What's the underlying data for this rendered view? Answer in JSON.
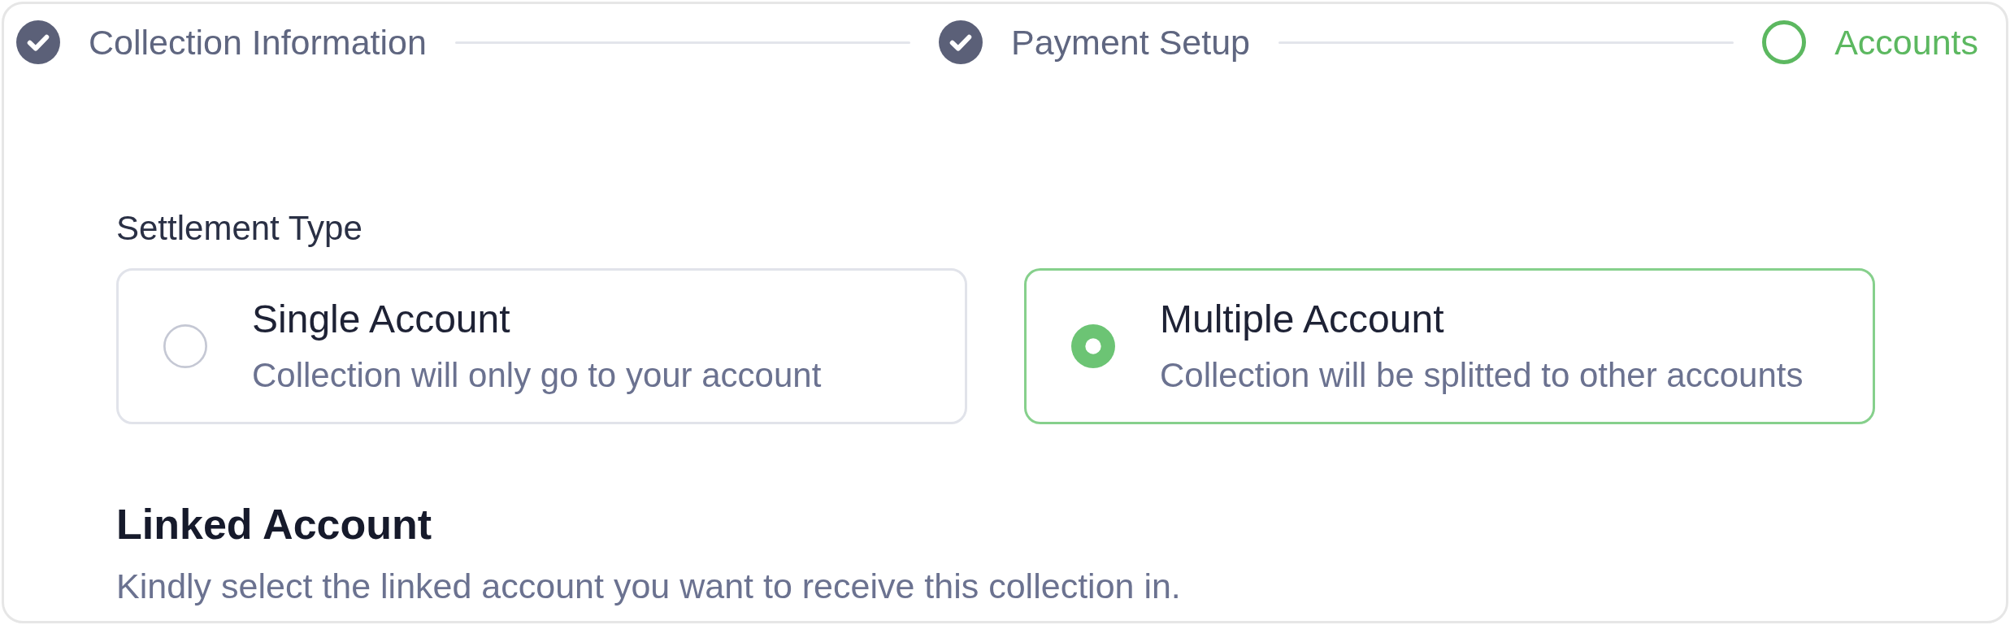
{
  "steps": [
    {
      "label": "Collection Information",
      "completed": true,
      "active": false
    },
    {
      "label": "Payment Setup",
      "completed": true,
      "active": false
    },
    {
      "label": "Accounts",
      "completed": false,
      "active": true
    }
  ],
  "settlement_type": {
    "label": "Settlement Type",
    "options": [
      {
        "title": "Single Account",
        "description": "Collection will only go to your account",
        "selected": false
      },
      {
        "title": "Multiple Account",
        "description": "Collection will be splitted to other accounts",
        "selected": true
      }
    ]
  },
  "linked_account": {
    "title": "Linked Account",
    "description": "Kindly select the linked account you want to receive this collection in."
  }
}
